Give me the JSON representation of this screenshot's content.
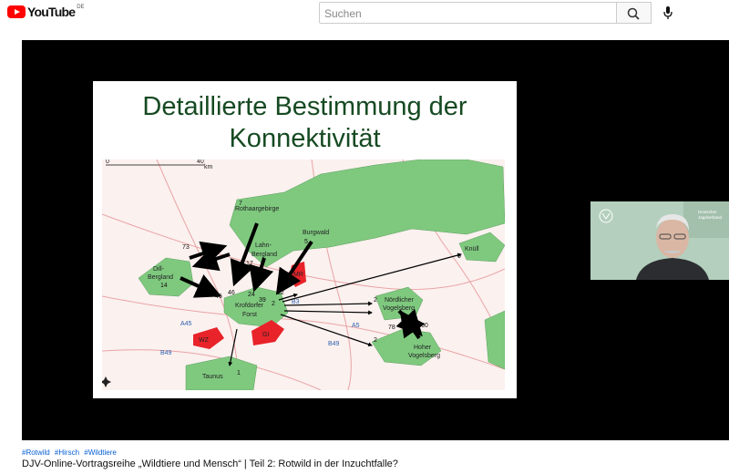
{
  "header": {
    "logo_text": "YouTube",
    "region": "DE",
    "search_placeholder": "Suchen",
    "icons": [
      "youtube-logo",
      "search-icon",
      "microphone-icon"
    ]
  },
  "slide": {
    "title_line1": "Detaillierte Bestimmung der",
    "title_line2": "Konnektivität"
  },
  "map": {
    "scale_start": "0",
    "scale_end": "40",
    "scale_unit": "km",
    "regions": {
      "rothaargebirge": "Rothaargebirge",
      "lahn_line1": "Lahn-",
      "lahn_line2": "Bergland",
      "burgwald": "Burgwald",
      "mr": "MR",
      "knuell": "Knüll",
      "dill_line1": "Dill-",
      "dill_line2": "Bergland",
      "krofdorfer_line1": "Krofdorfer",
      "krofdorfer_line2": "Forst",
      "noerdlicher_line1": "Nördlicher",
      "noerdlicher_line2": "Vogelsberg",
      "wz": "WZ",
      "gi": "GI",
      "hoher_line1": "Hoher",
      "hoher_line2": "Vogelsberg",
      "taunus": "Taunus"
    },
    "roads": {
      "a45": "A45",
      "b49_left": "B49",
      "b3": "B3",
      "a5": "A5",
      "b49_right": "B49"
    },
    "numbers": {
      "n7": "7",
      "n73": "73",
      "n58": "58",
      "n17": "17",
      "n5": "5",
      "n0": "0",
      "n14": "14",
      "n46a": "46",
      "n46b": "46",
      "n24": "24",
      "n39": "39",
      "n12": "12",
      "n2a": "2",
      "n2b": "2",
      "n2c": "2",
      "n78": "78",
      "n60": "60",
      "n1": "1"
    }
  },
  "video": {
    "hashtags": [
      "#Rotwild",
      "#Hirsch",
      "#Wildtiere"
    ],
    "title": "DJV-Online-Vortragsreihe „Wildtiere und Mensch“ | Teil 2: Rotwild in der Inzuchtfalle?",
    "webcam_logo_text_line1": "Deutscher",
    "webcam_logo_text_line2": "Jagdverband"
  },
  "colors": {
    "brand_red": "#ff0000",
    "slide_title": "#164a22",
    "forest_green": "#7fc97f",
    "city_red": "#e8232a",
    "hashtag_blue": "#065fd4"
  }
}
